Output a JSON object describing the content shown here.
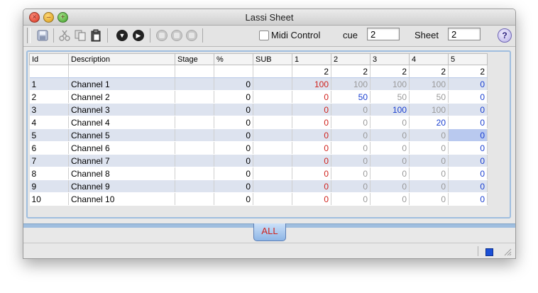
{
  "window": {
    "title": "Lassi Sheet"
  },
  "toolbar": {
    "midi_label": "Midi Control",
    "cue_label": "cue",
    "cue_value": "2",
    "sheet_label": "Sheet",
    "sheet_value": "2",
    "help_label": "?",
    "icons": [
      "save-icon",
      "cut-icon",
      "copy-icon",
      "paste-icon",
      "down-arrow-icon",
      "play-icon",
      "stop-icon",
      "stop-icon",
      "stop-icon"
    ]
  },
  "table": {
    "headers": [
      "Id",
      "Description",
      "Stage",
      "%",
      "SUB",
      "1",
      "2",
      "3",
      "4",
      "5"
    ],
    "cue_row": [
      "2",
      "2",
      "2",
      "2",
      "2"
    ],
    "rows": [
      {
        "id": "1",
        "desc": "Channel 1",
        "pct": "0",
        "cues": [
          "100",
          "100",
          "100",
          "100",
          "0"
        ]
      },
      {
        "id": "2",
        "desc": "Channel 2",
        "pct": "0",
        "cues": [
          "0",
          "50",
          "50",
          "50",
          "0"
        ]
      },
      {
        "id": "3",
        "desc": "Channel 3",
        "pct": "0",
        "cues": [
          "0",
          "0",
          "100",
          "100",
          "0"
        ]
      },
      {
        "id": "4",
        "desc": "Channel 4",
        "pct": "0",
        "cues": [
          "0",
          "0",
          "0",
          "20",
          "0"
        ]
      },
      {
        "id": "5",
        "desc": "Channel 5",
        "pct": "0",
        "cues": [
          "0",
          "0",
          "0",
          "0",
          "0"
        ]
      },
      {
        "id": "6",
        "desc": "Channel 6",
        "pct": "0",
        "cues": [
          "0",
          "0",
          "0",
          "0",
          "0"
        ]
      },
      {
        "id": "7",
        "desc": "Channel 7",
        "pct": "0",
        "cues": [
          "0",
          "0",
          "0",
          "0",
          "0"
        ]
      },
      {
        "id": "8",
        "desc": "Channel 8",
        "pct": "0",
        "cues": [
          "0",
          "0",
          "0",
          "0",
          "0"
        ]
      },
      {
        "id": "9",
        "desc": "Channel 9",
        "pct": "0",
        "cues": [
          "0",
          "0",
          "0",
          "0",
          "0"
        ]
      },
      {
        "id": "10",
        "desc": "Channel 10",
        "pct": "0",
        "cues": [
          "0",
          "0",
          "0",
          "0",
          "0"
        ]
      }
    ]
  },
  "tabs": {
    "all_label": "ALL"
  },
  "colors": {
    "red": "#d0231d",
    "gray": "#9a9a9a",
    "blue": "#1a3fd0",
    "accent": "#9fbedf"
  }
}
